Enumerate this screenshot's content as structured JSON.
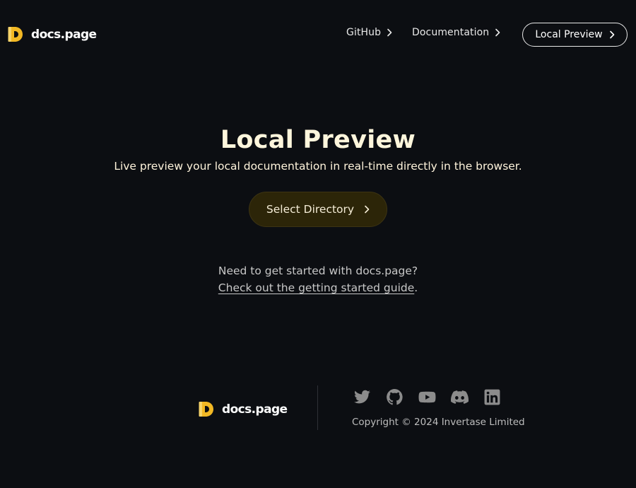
{
  "header": {
    "brand": "docs.page",
    "nav": {
      "github_label": "GitHub",
      "docs_label": "Documentation",
      "preview_label": "Local Preview"
    }
  },
  "hero": {
    "title": "Local Preview",
    "subtitle": "Live preview your local documentation in real-time directly in the browser.",
    "button_label": "Select Directory",
    "hint_line1": "Need to get started with docs.page?",
    "hint_link": "Check out the getting started guide",
    "hint_suffix": "."
  },
  "footer": {
    "brand": "docs.page",
    "copyright": "Copyright © 2024 Invertase Limited",
    "socials": [
      "twitter-icon",
      "github-icon",
      "youtube-icon",
      "discord-icon",
      "linkedin-icon"
    ]
  },
  "colors": {
    "background": "#0c0e12",
    "brand_yellow": "#f2b824",
    "title": "#fff6dc",
    "button_bg": "#2c2508",
    "social_icon": "#8c8c8c"
  }
}
